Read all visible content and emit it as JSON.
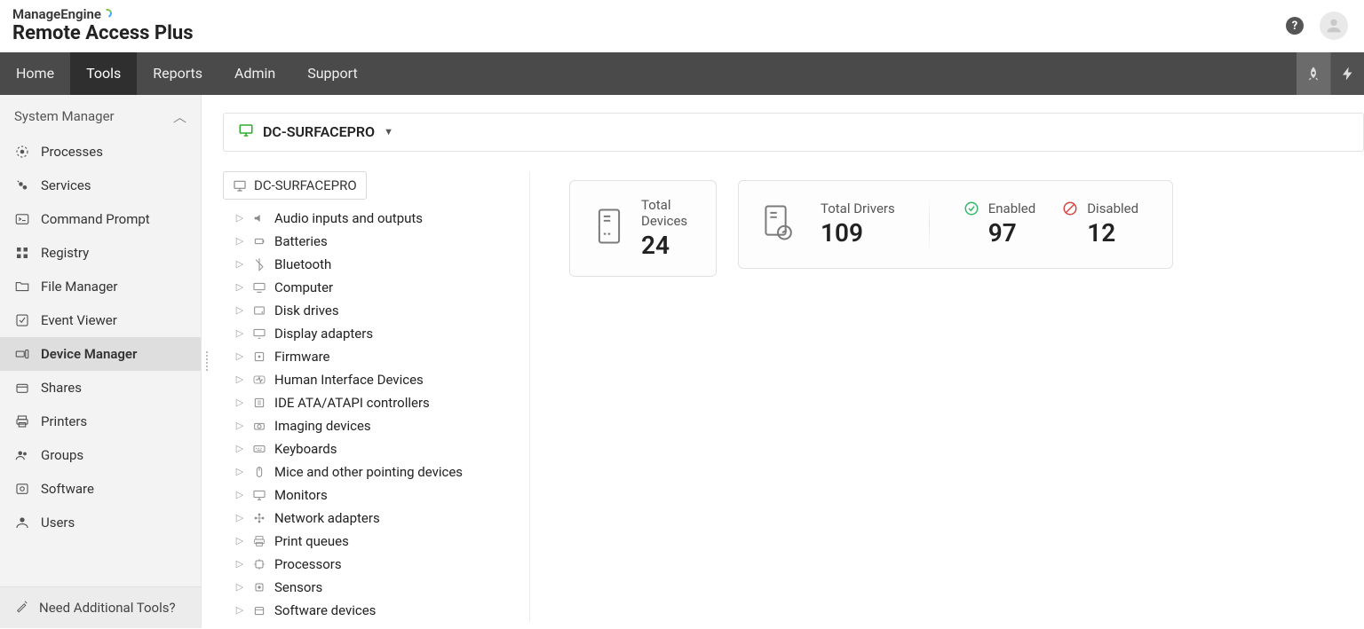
{
  "brand": {
    "line1": "ManageEngine",
    "line2": "Remote Access Plus"
  },
  "nav": {
    "items": [
      {
        "label": "Home",
        "active": false
      },
      {
        "label": "Tools",
        "active": true
      },
      {
        "label": "Reports",
        "active": false
      },
      {
        "label": "Admin",
        "active": false
      },
      {
        "label": "Support",
        "active": false
      }
    ]
  },
  "sidebar": {
    "header": "System Manager",
    "items": [
      {
        "label": "Processes",
        "icon": "processes",
        "active": false
      },
      {
        "label": "Services",
        "icon": "services",
        "active": false
      },
      {
        "label": "Command Prompt",
        "icon": "terminal",
        "active": false
      },
      {
        "label": "Registry",
        "icon": "registry",
        "active": false
      },
      {
        "label": "File Manager",
        "icon": "folder",
        "active": false
      },
      {
        "label": "Event Viewer",
        "icon": "event",
        "active": false
      },
      {
        "label": "Device Manager",
        "icon": "device",
        "active": true
      },
      {
        "label": "Shares",
        "icon": "shares",
        "active": false
      },
      {
        "label": "Printers",
        "icon": "printer",
        "active": false
      },
      {
        "label": "Groups",
        "icon": "groups",
        "active": false
      },
      {
        "label": "Software",
        "icon": "software",
        "active": false
      },
      {
        "label": "Users",
        "icon": "users",
        "active": false
      }
    ],
    "footer": "Need Additional Tools?"
  },
  "machine": {
    "name": "DC-SURFACEPRO"
  },
  "tree": {
    "root": "DC-SURFACEPRO",
    "categories": [
      "Audio inputs and outputs",
      "Batteries",
      "Bluetooth",
      "Computer",
      "Disk drives",
      "Display adapters",
      "Firmware",
      "Human Interface Devices",
      "IDE ATA/ATAPI controllers",
      "Imaging devices",
      "Keyboards",
      "Mice and other pointing devices",
      "Monitors",
      "Network adapters",
      "Print queues",
      "Processors",
      "Sensors",
      "Software devices"
    ]
  },
  "metrics": {
    "total_devices": {
      "label": "Total Devices",
      "value": "24"
    },
    "total_drivers": {
      "label": "Total Drivers",
      "value": "109"
    },
    "enabled": {
      "label": "Enabled",
      "value": "97"
    },
    "disabled": {
      "label": "Disabled",
      "value": "12"
    }
  }
}
